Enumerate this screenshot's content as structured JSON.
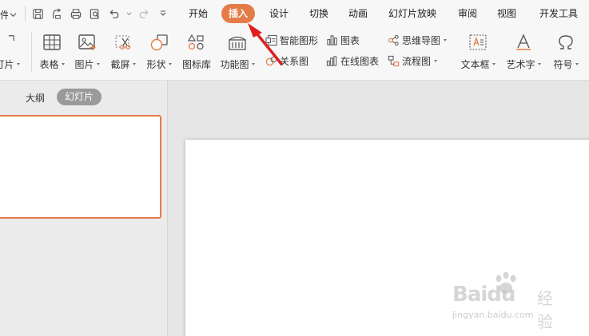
{
  "colors": {
    "accent": "#e47c48",
    "ribbon_bg": "#f7f7f7",
    "workspace_bg": "#e6e6e6",
    "pill_bg": "#9a9a9a",
    "arrow": "#e02020"
  },
  "qa": {
    "file_fragment": "件"
  },
  "menu": {
    "home": "开始",
    "insert": "插入",
    "design": "设计",
    "transitions": "切换",
    "animations": "动画",
    "slideshow": "幻灯片放映",
    "review": "审阅",
    "view": "视图",
    "developer": "开发工具"
  },
  "tools": {
    "slides_fragment": "灯片",
    "table": "表格",
    "picture": "图片",
    "screenshot": "截屏",
    "shapes": "形状",
    "icon_library": "图标库",
    "function_chart": "功能图",
    "smartart": "智能图形",
    "chart": "图表",
    "relation": "关系图",
    "online_chart": "在线图表",
    "mindmap": "思维导图",
    "flowchart": "流程图",
    "textbox": "文本框",
    "wordart": "艺术字",
    "symbol": "符号"
  },
  "panel": {
    "outline_tab": "大纲",
    "slides_tab": "幻灯片"
  },
  "watermark": {
    "logo": "Baidu",
    "text": "经验",
    "url": "jingyan.baidu.com"
  }
}
